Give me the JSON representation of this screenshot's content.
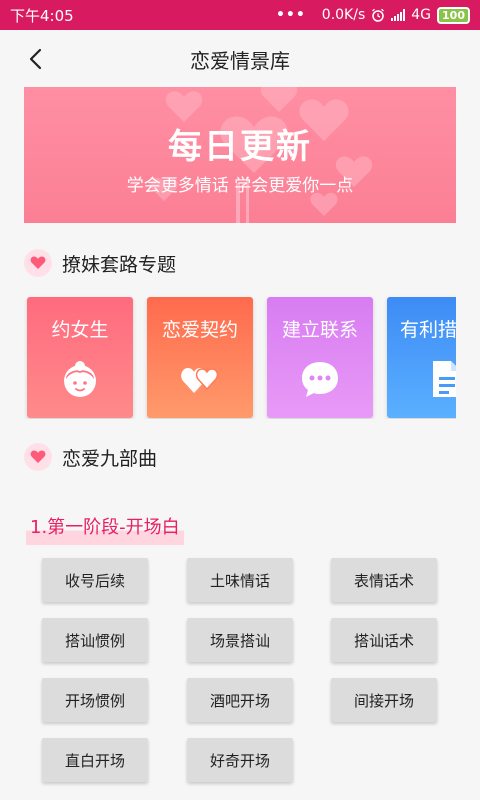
{
  "status_bar": {
    "time": "下午4:05",
    "network_speed": "0.0K/s",
    "network_type": "4G",
    "battery": "100",
    "background_color": "#d81b60"
  },
  "header": {
    "title": "恋爱情景库",
    "back_icon": "chevron-left-icon"
  },
  "banner": {
    "title": "每日更新",
    "subtitle": "学会更多情话  学会更爱你一点"
  },
  "section_topics": {
    "title": "撩妹套路专题",
    "cards": [
      {
        "label": "约女生",
        "icon": "girl-face-icon",
        "color_top": "#ff6b7f",
        "color_bottom": "#ff8a8a"
      },
      {
        "label": "恋爱契约",
        "icon": "two-hearts-icon",
        "color_top": "#ff6a4d",
        "color_bottom": "#ff9a6b"
      },
      {
        "label": "建立联系",
        "icon": "chat-bubble-icon",
        "color_top": "#d77cf2",
        "color_bottom": "#e99af7"
      },
      {
        "label": "有利措",
        "icon": "document-icon",
        "color_top": "#3d8bf5",
        "color_bottom": "#5bb0ff"
      }
    ]
  },
  "section_nine": {
    "title": "恋爱九部曲"
  },
  "stage": {
    "title": "1.第一阶段-开场白",
    "items": [
      "收号后续",
      "土味情话",
      "表情话术",
      "搭讪惯例",
      "场景搭讪",
      "搭讪话术",
      "开场惯例",
      "酒吧开场",
      "间接开场",
      "直白开场",
      "好奇开场"
    ]
  },
  "accent_color": "#e91e63"
}
